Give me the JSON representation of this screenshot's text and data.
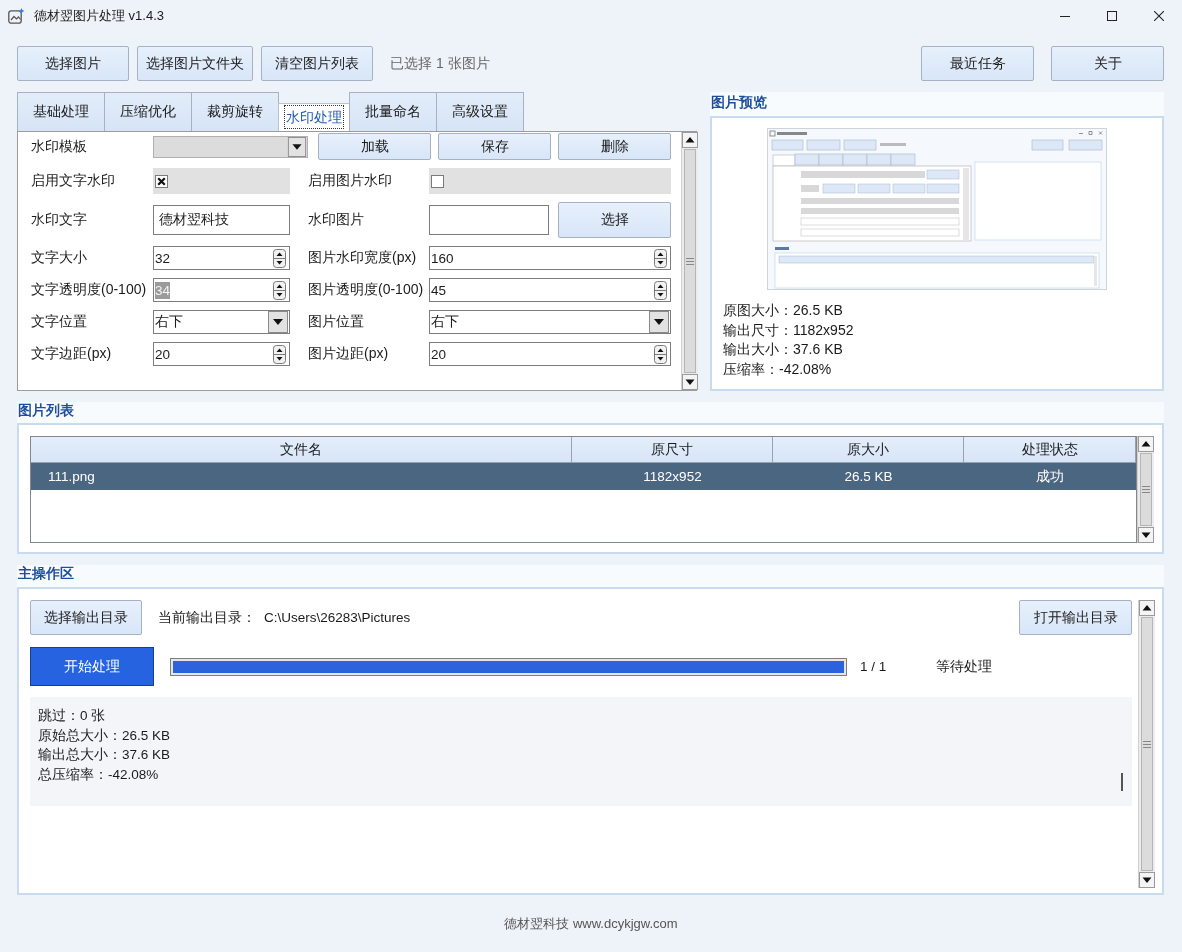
{
  "window": {
    "title": "德材翌图片处理 v1.4.3"
  },
  "toolbar": {
    "buttons": [
      {
        "label": "选择图片"
      },
      {
        "label": "选择图片文件夹"
      },
      {
        "label": "清空图片列表"
      }
    ],
    "selection_info": "已选择 1 张图片",
    "right_buttons": [
      {
        "label": "最近任务"
      },
      {
        "label": "关于"
      }
    ]
  },
  "tabs": [
    {
      "label": "基础处理",
      "selected": false
    },
    {
      "label": "压缩优化",
      "selected": false
    },
    {
      "label": "裁剪旋转",
      "selected": false
    },
    {
      "label": "水印处理",
      "selected": true
    },
    {
      "label": "批量命名",
      "selected": false
    },
    {
      "label": "高级设置",
      "selected": false
    }
  ],
  "watermark_settings": {
    "rows": [
      {
        "kind": "template",
        "label": "水印模板",
        "buttons": [
          {
            "label": "加载"
          },
          {
            "label": "保存"
          },
          {
            "label": "删除"
          }
        ]
      },
      {
        "kind": "fields",
        "left": {
          "label": "启用文字水印",
          "kind": "checkbox",
          "checked": true
        },
        "right": {
          "label": "启用图片水印",
          "kind": "checkbox",
          "checked": false
        }
      },
      {
        "kind": "fields",
        "left": {
          "label": "水印文字",
          "kind": "text",
          "value": "德材翌科技",
          "text_selected": false
        },
        "right": {
          "label": "水印图片",
          "kind": "file",
          "button": "选择"
        }
      },
      {
        "kind": "fields",
        "left": {
          "label": "文字大小",
          "kind": "spin",
          "value": "32",
          "text_selected": false
        },
        "right": {
          "label": "图片水印宽度(px)",
          "kind": "spin",
          "value": "160",
          "text_selected": false
        }
      },
      {
        "kind": "fields",
        "left": {
          "label": "文字透明度(0-100)",
          "kind": "spin",
          "value": "34",
          "text_selected": true
        },
        "right": {
          "label": "图片透明度(0-100)",
          "kind": "spin",
          "value": "45",
          "text_selected": false
        }
      },
      {
        "kind": "fields",
        "left": {
          "label": "文字位置",
          "kind": "combo",
          "value": "右下"
        },
        "right": {
          "label": "图片位置",
          "kind": "combo",
          "value": "右下"
        }
      },
      {
        "kind": "fields",
        "left": {
          "label": "文字边距(px)",
          "kind": "spin",
          "value": "20",
          "text_selected": false
        },
        "right": {
          "label": "图片边距(px)",
          "kind": "spin",
          "value": "20",
          "text_selected": false
        }
      }
    ]
  },
  "preview": {
    "title": "图片预览",
    "info": [
      "原图大小：26.5 KB",
      "输出尺寸：1182x952",
      "输出大小：37.6 KB",
      "压缩率：-42.08%"
    ]
  },
  "image_list": {
    "title": "图片列表",
    "columns": [
      "文件名",
      "原尺寸",
      "原大小",
      "处理状态"
    ],
    "rows": [
      {
        "cells": [
          "111.png",
          "1182x952",
          "26.5 KB",
          "成功"
        ],
        "selected": true
      }
    ]
  },
  "main_area": {
    "title": "主操作区",
    "choose_button": "选择输出目录",
    "output_dir_label": "当前输出目录：",
    "output_dir": "C:\\Users\\26283\\Pictures",
    "open_button": "打开输出目录",
    "start_button": "开始处理",
    "progress": {
      "level": 1
    },
    "progress_text": "1 / 1",
    "status": "等待处理",
    "log": [
      "跳过：0 张",
      "原始总大小：26.5 KB",
      "输出总大小：37.6 KB",
      "总压缩率：-42.08%"
    ]
  },
  "footer": "德材翌科技 www.dcykjgw.com"
}
